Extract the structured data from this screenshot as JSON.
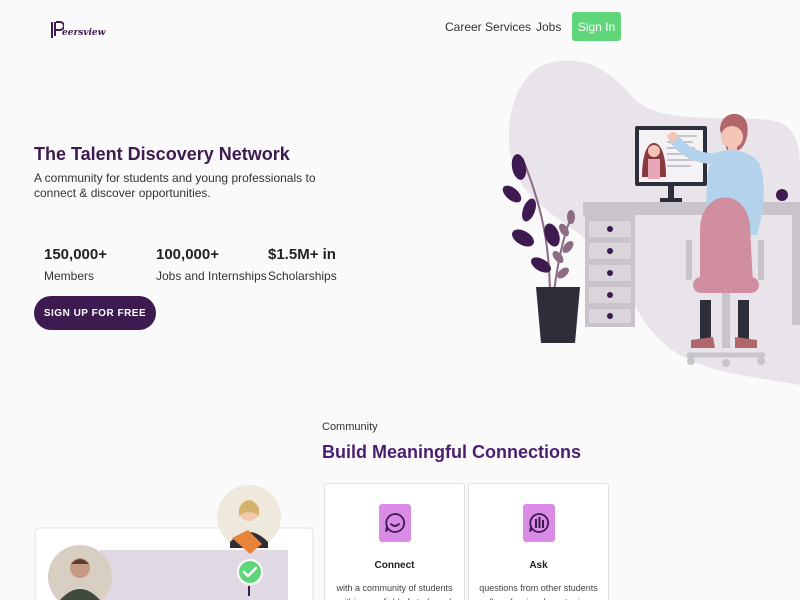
{
  "nav": {
    "logo_text": "eersview",
    "links": [
      "Career Services",
      "Jobs"
    ],
    "signin_label": "Sign In"
  },
  "hero": {
    "title": "The Talent Discovery Network",
    "subtitle": "A community for students and young professionals to connect & discover opportunities.",
    "stats": [
      {
        "number": "150,000+",
        "label": "Members"
      },
      {
        "number": "100,000+",
        "label": "Jobs and Internships"
      },
      {
        "number": "$1.5M+ in",
        "label": "Scholarships"
      }
    ],
    "cta_label": "SIGN UP FOR FREE"
  },
  "community": {
    "eyebrow": "Community",
    "title": "Build Meaningful Connections",
    "cards": [
      {
        "icon": "chat-smile-icon",
        "title": "Connect",
        "text": "with a community of students within your field of study and"
      },
      {
        "icon": "chat-question-icon",
        "title": "Ask",
        "text": "questions from other students & professionals on topics relating"
      }
    ]
  },
  "colors": {
    "brand": "#3d1a4f",
    "accent_green": "#5fd67a",
    "heading_purple": "#4b1f6f",
    "icon_pink": "#d98be6",
    "blob": "#e8e4ea"
  }
}
